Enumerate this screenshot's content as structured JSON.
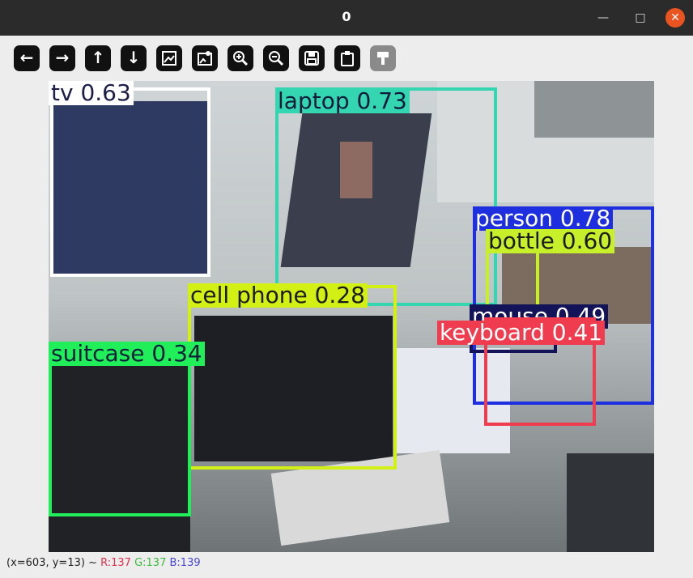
{
  "window": {
    "title": "0",
    "min_icon": "minimize-icon",
    "max_icon": "maximize-icon",
    "close_icon": "close-icon"
  },
  "toolbar": [
    {
      "name": "pan-left-button",
      "icon": "arrow-left-icon",
      "glyph": "←"
    },
    {
      "name": "pan-right-button",
      "icon": "arrow-right-icon",
      "glyph": "→"
    },
    {
      "name": "pan-up-button",
      "icon": "arrow-up-icon",
      "glyph": "↑"
    },
    {
      "name": "pan-down-button",
      "icon": "arrow-down-icon",
      "glyph": "↓"
    },
    {
      "name": "zoom-to-window-button",
      "icon": "image-icon",
      "glyph": ""
    },
    {
      "name": "original-size-button",
      "icon": "image-fit-icon",
      "glyph": ""
    },
    {
      "name": "zoom-in-button",
      "icon": "zoom-in-icon",
      "glyph": ""
    },
    {
      "name": "zoom-out-button",
      "icon": "zoom-out-icon",
      "glyph": ""
    },
    {
      "name": "save-button",
      "icon": "save-icon",
      "glyph": ""
    },
    {
      "name": "properties-button",
      "icon": "clipboard-icon",
      "glyph": ""
    },
    {
      "name": "overlay-button",
      "icon": "paint-icon",
      "glyph": "",
      "disabled": true
    }
  ],
  "detections": [
    {
      "label": "tv 0.63",
      "color": "#ffffff",
      "text_color": "#1d1d4a"
    },
    {
      "label": "laptop 0.73",
      "color": "#33d6b0",
      "text_color": "#0d1a3a"
    },
    {
      "label": "person 0.78",
      "color": "#1e2fe0",
      "text_color": "#ffffff"
    },
    {
      "label": "bottle 0.60",
      "color": "#c7f02a",
      "text_color": "#1b1b1b"
    },
    {
      "label": "cell phone 0.28",
      "color": "#d2f014",
      "text_color": "#1b1b1b"
    },
    {
      "label": "mouse 0.49",
      "color": "#13135a",
      "text_color": "#ffffff"
    },
    {
      "label": "keyboard 0.41",
      "color": "#ef3c4e",
      "text_color": "#ffffff"
    },
    {
      "label": "suitcase 0.34",
      "color": "#20ef5a",
      "text_color": "#10203a"
    }
  ],
  "status": {
    "coords": "(x=603, y=13) ~",
    "r": "R:137",
    "g": "G:137",
    "b": "B:139",
    "r_color": "#e0304a",
    "g_color": "#3dbb3d",
    "b_color": "#4747d6"
  }
}
